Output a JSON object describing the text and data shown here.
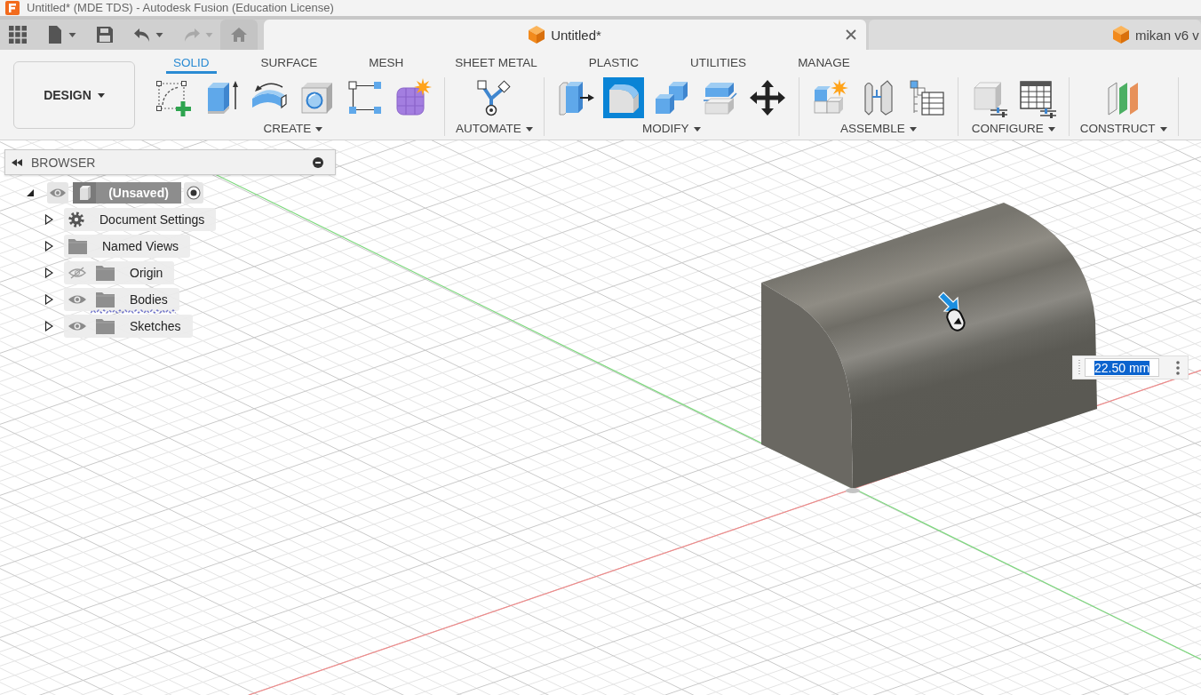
{
  "window": {
    "title": "Untitled* (MDE TDS) - Autodesk Fusion (Education License)"
  },
  "quick_access": [
    {
      "kind": "apps",
      "dropdown": false,
      "disabled": false
    },
    {
      "kind": "file",
      "dropdown": true,
      "disabled": false
    },
    {
      "kind": "save",
      "dropdown": false,
      "disabled": false
    },
    {
      "kind": "undo",
      "dropdown": true,
      "disabled": false
    },
    {
      "kind": "redo",
      "dropdown": true,
      "disabled": true
    }
  ],
  "document_tabs": [
    {
      "label": "Untitled*",
      "selected": true
    },
    {
      "label": "mikan v6 v",
      "selected": false
    }
  ],
  "workspace": {
    "label": "DESIGN"
  },
  "toolbar_tabs": [
    {
      "label": "SOLID",
      "selected": true
    },
    {
      "label": "SURFACE",
      "selected": false
    },
    {
      "label": "MESH",
      "selected": false
    },
    {
      "label": "SHEET METAL",
      "selected": false
    },
    {
      "label": "PLASTIC",
      "selected": false
    },
    {
      "label": "UTILITIES",
      "selected": false
    },
    {
      "label": "MANAGE",
      "selected": false
    }
  ],
  "tool_groups": [
    {
      "label": "CREATE",
      "tools": [
        {
          "kind": "create_sketch",
          "selected": false
        },
        {
          "kind": "extrude",
          "selected": false
        },
        {
          "kind": "revolve",
          "selected": false
        },
        {
          "kind": "hole",
          "selected": false
        },
        {
          "kind": "pattern",
          "selected": false
        },
        {
          "kind": "form",
          "selected": false
        }
      ]
    },
    {
      "label": "AUTOMATE",
      "tools": [
        {
          "kind": "automate",
          "selected": false
        }
      ]
    },
    {
      "label": "MODIFY",
      "tools": [
        {
          "kind": "press_pull",
          "selected": false
        },
        {
          "kind": "fillet",
          "selected": true
        },
        {
          "kind": "combine",
          "selected": false
        },
        {
          "kind": "offset_face",
          "selected": false
        },
        {
          "kind": "move",
          "selected": false
        }
      ]
    },
    {
      "label": "ASSEMBLE",
      "tools": [
        {
          "kind": "new_component",
          "selected": false
        },
        {
          "kind": "joint",
          "selected": false
        },
        {
          "kind": "bom_table",
          "selected": false
        }
      ]
    },
    {
      "label": "CONFIGURE",
      "tools": [
        {
          "kind": "configure_model",
          "selected": false
        },
        {
          "kind": "configure_table",
          "selected": false
        }
      ]
    },
    {
      "label": "CONSTRUCT",
      "tools": [
        {
          "kind": "offset_plane",
          "selected": false
        }
      ]
    }
  ],
  "browser": {
    "title": "BROWSER",
    "root": {
      "label": "(Unsaved)",
      "expanded": true,
      "visible": true,
      "active": true,
      "children": [
        {
          "label": "Document Settings",
          "kind": "settings",
          "expanded": false,
          "marked": false
        },
        {
          "label": "Named Views",
          "kind": "views",
          "expanded": false,
          "marked": false
        },
        {
          "label": "Origin",
          "kind": "folder",
          "expanded": false,
          "visible": false,
          "marked": false
        },
        {
          "label": "Bodies",
          "kind": "folder",
          "expanded": false,
          "visible": true,
          "marked": true
        },
        {
          "label": "Sketches",
          "kind": "folder",
          "expanded": false,
          "visible": true,
          "marked": false
        }
      ]
    }
  },
  "viewport": {
    "dimension": {
      "value": "22.50 mm",
      "value_selected": true
    }
  }
}
